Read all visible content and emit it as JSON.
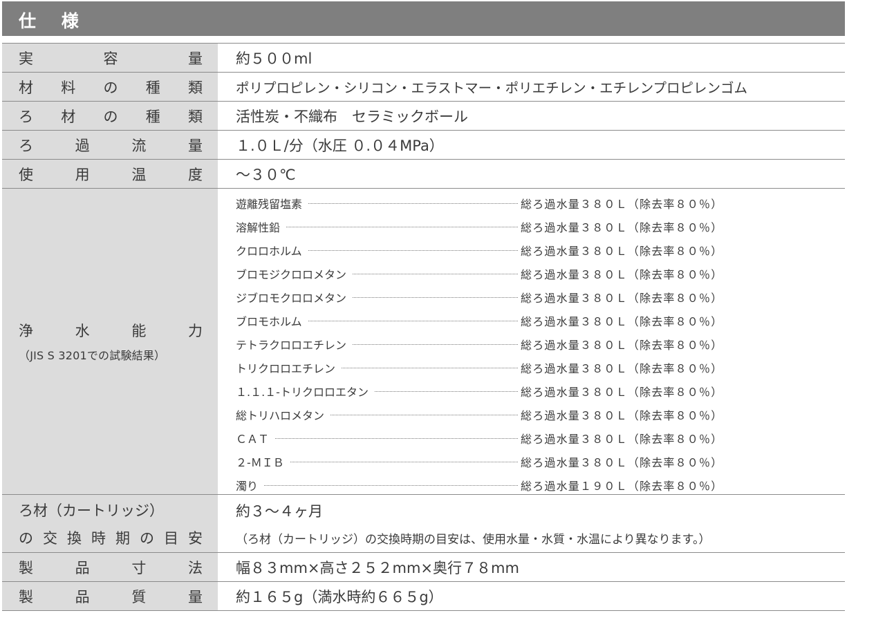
{
  "title": "仕 様",
  "rows": [
    {
      "label": "実容量",
      "label_chars": [
        "実",
        "容",
        "量"
      ],
      "value": "約５００ml"
    },
    {
      "label": "材料の種類",
      "label_chars": [
        "材",
        "料",
        "の",
        "種",
        "類"
      ],
      "value": "ポリプロピレン・シリコン・エラストマー・ポリエチレン・エチレンプロピレンゴム"
    },
    {
      "label": "ろ材の種類",
      "label_chars": [
        "ろ",
        "材",
        "の",
        "種",
        "類"
      ],
      "value": "活性炭・不織布　セラミックボール"
    },
    {
      "label": "ろ過流量",
      "label_chars": [
        "ろ",
        "過",
        "流",
        "量"
      ],
      "value": "１.０Ｌ/分（水圧 ０.０４MPa）"
    },
    {
      "label": "使用温度",
      "label_chars": [
        "使",
        "用",
        "温",
        "度"
      ],
      "value": "～３０℃"
    }
  ],
  "performance": {
    "label_chars": [
      "浄",
      "水",
      "能",
      "力"
    ],
    "sublabel": "（JIS S 3201での試験結果）",
    "items": [
      {
        "name": "遊離残留塩素",
        "result": "総ろ過水量３８０Ｌ（除去率８０％）"
      },
      {
        "name": "溶解性鉛",
        "result": "総ろ過水量３８０Ｌ（除去率８０％）"
      },
      {
        "name": "クロロホルム",
        "result": "総ろ過水量３８０Ｌ（除去率８０％）"
      },
      {
        "name": "ブロモジクロロメタン",
        "result": "総ろ過水量３８０Ｌ（除去率８０％）"
      },
      {
        "name": "ジブロモクロロメタン",
        "result": "総ろ過水量３８０Ｌ（除去率８０％）"
      },
      {
        "name": "ブロモホルム",
        "result": "総ろ過水量３８０Ｌ（除去率８０％）"
      },
      {
        "name": "テトラクロロエチレン",
        "result": "総ろ過水量３８０Ｌ（除去率８０％）"
      },
      {
        "name": "トリクロロエチレン",
        "result": "総ろ過水量３８０Ｌ（除去率８０％）"
      },
      {
        "name": "１.１.１-トリクロロエタン",
        "result": "総ろ過水量３８０Ｌ（除去率８０％）"
      },
      {
        "name": "総トリハロメタン",
        "result": "総ろ過水量３８０Ｌ（除去率８０％）"
      },
      {
        "name": "ＣＡＴ",
        "result": "総ろ過水量３８０Ｌ（除去率８０％）"
      },
      {
        "name": "２-ＭＩＢ",
        "result": "総ろ過水量３８０Ｌ（除去率８０％）"
      },
      {
        "name": "濁り",
        "result": "総ろ過水量１９０Ｌ（除去率８０％）"
      }
    ]
  },
  "cartridge": {
    "label_line1": "ろ材（カートリッジ）",
    "label_line2_chars": [
      "の",
      "交",
      "換",
      "時",
      "期",
      "の",
      "目",
      "安"
    ],
    "value": "約３～４ヶ月",
    "note": "（ろ材（カートリッジ）の交換時期の目安は、使用水量・水質・水温により異なります。）"
  },
  "rows_bottom": [
    {
      "label_chars": [
        "製",
        "品",
        "寸",
        "法"
      ],
      "value": "幅８３mm×高さ２５２mm×奥行７８mm"
    },
    {
      "label_chars": [
        "製",
        "品",
        "質",
        "量"
      ],
      "value": "約１６５g（満水時約６６５g）"
    }
  ]
}
